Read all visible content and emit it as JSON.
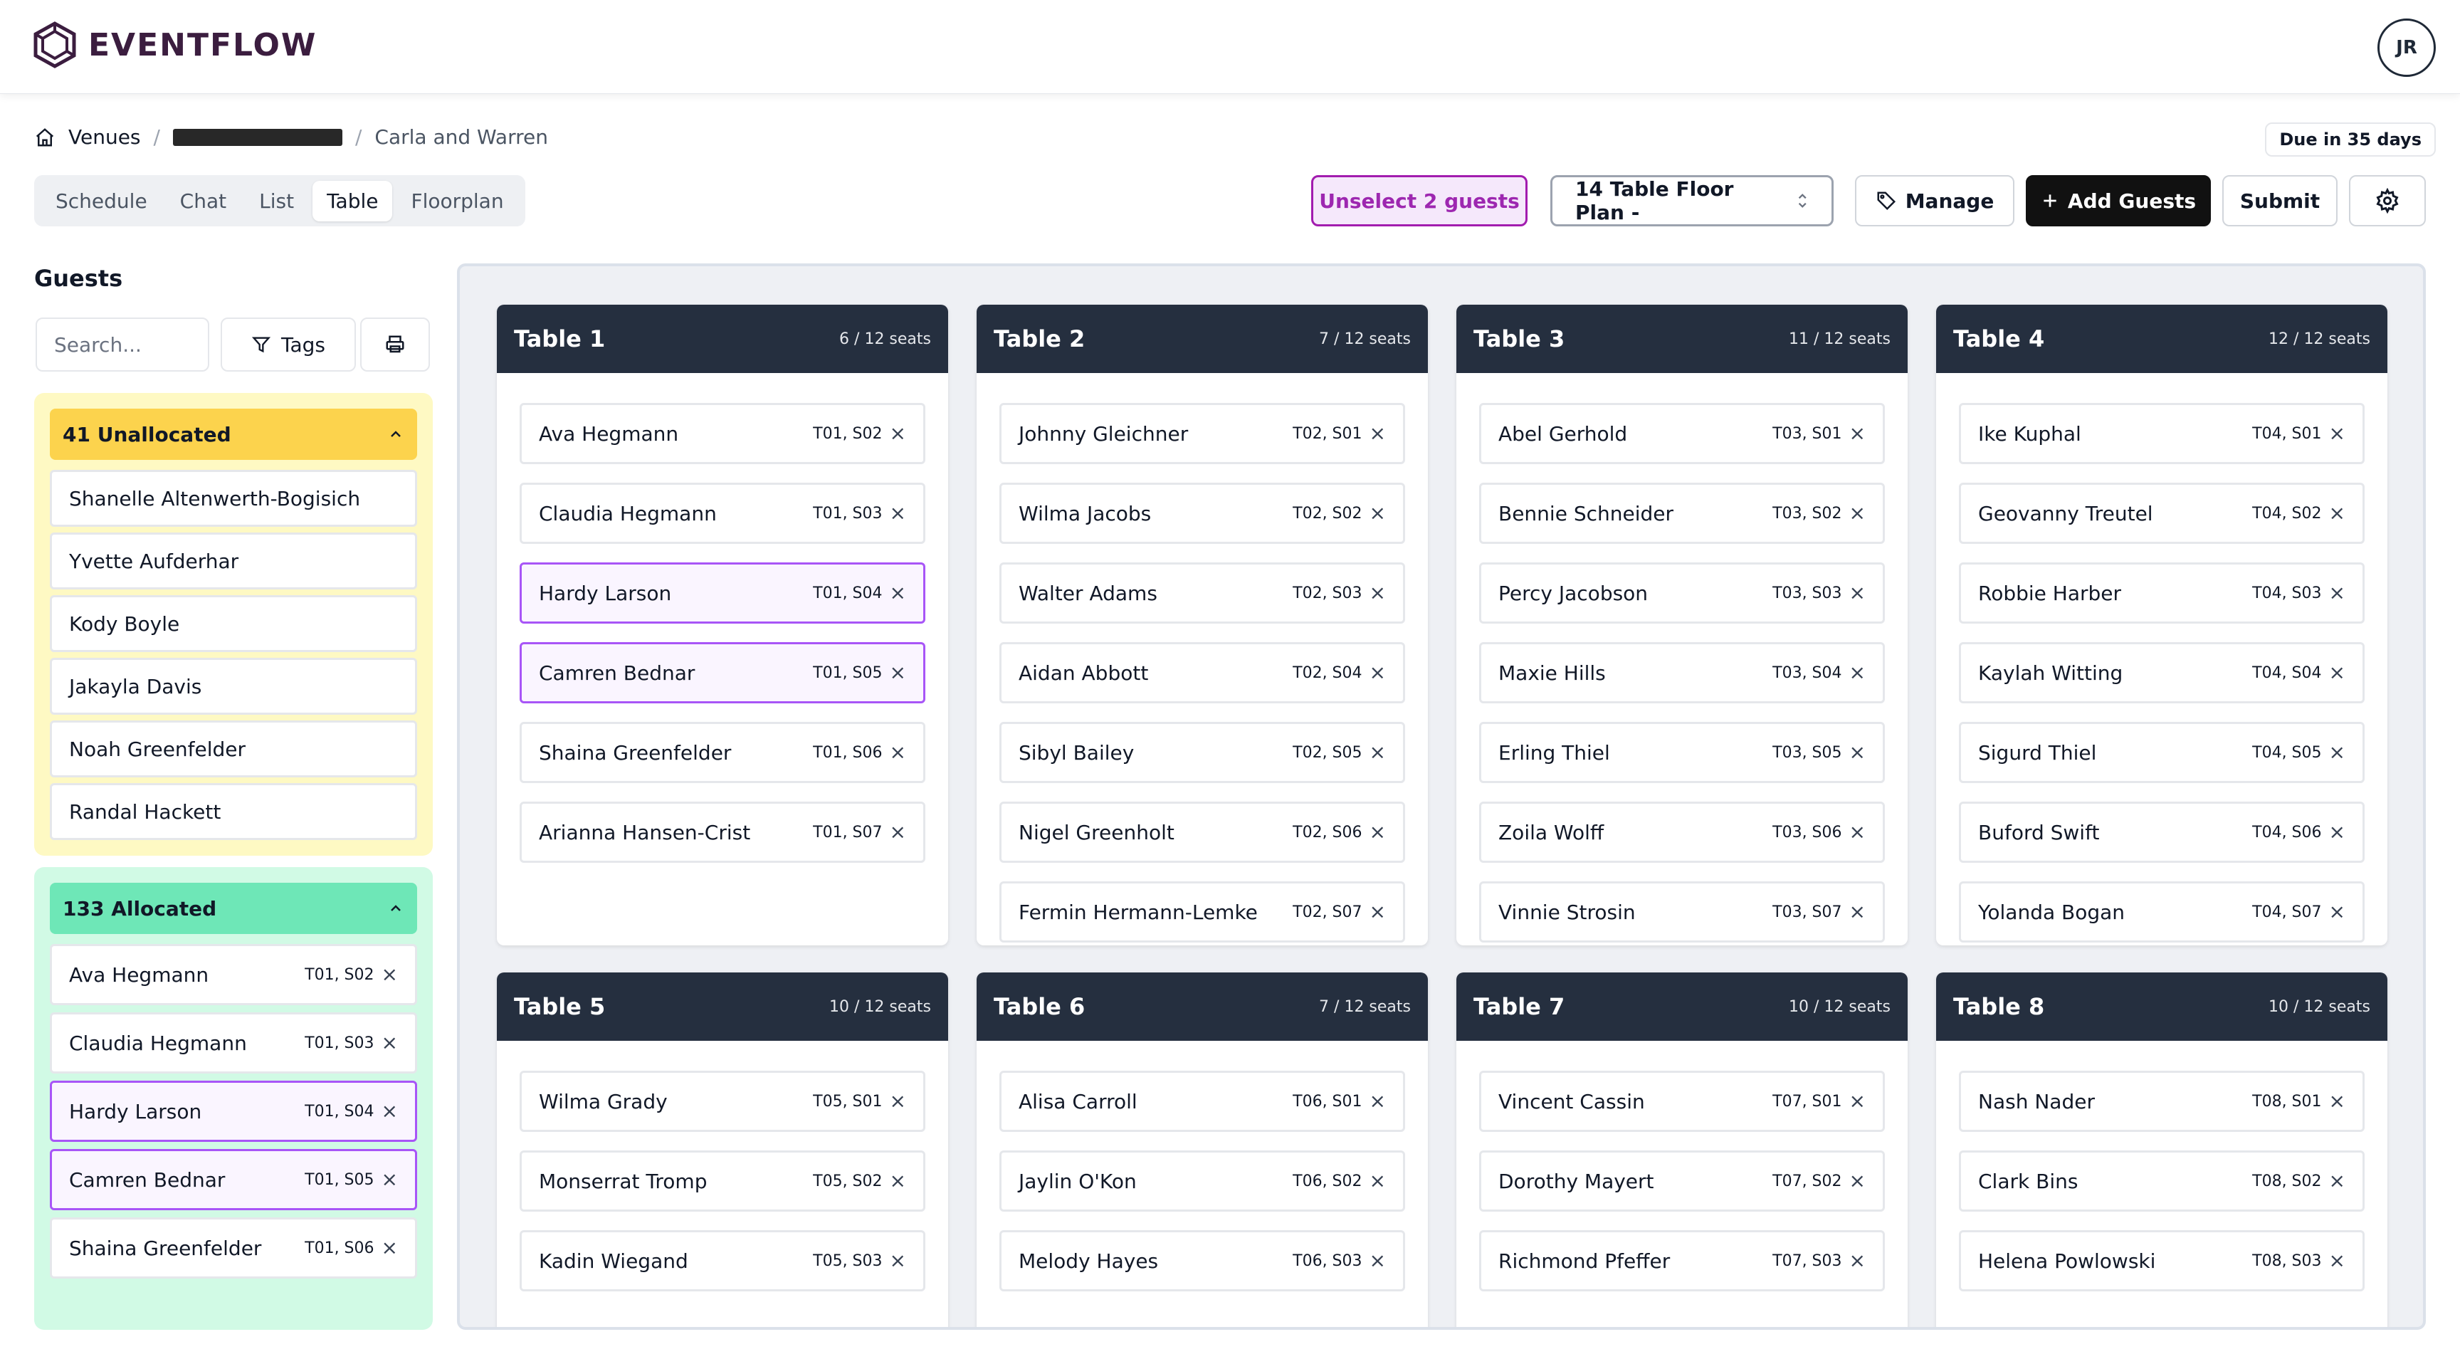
{
  "app": {
    "name": "EVENTFLOW",
    "user_initials": "JR"
  },
  "breadcrumb": {
    "venues": "Venues",
    "sep": "/",
    "current": "Carla and Warren"
  },
  "due": "Due in 35 days",
  "tabs": [
    "Schedule",
    "Chat",
    "List",
    "Table",
    "Floorplan"
  ],
  "active_tab": "Table",
  "toolbar": {
    "unselect": "Unselect 2 guests",
    "floorplan": "14 Table Floor Plan -",
    "manage": "Manage",
    "add_guests": "Add Guests",
    "submit": "Submit"
  },
  "sidebar": {
    "title": "Guests",
    "search_placeholder": "Search...",
    "tags": "Tags",
    "unallocated": {
      "label": "41 Unallocated",
      "items": [
        "Shanelle Altenwerth-Bogisich",
        "Yvette Aufderhar",
        "Kody Boyle",
        "Jakayla Davis",
        "Noah Greenfelder",
        "Randal Hackett"
      ]
    },
    "allocated": {
      "label": "133 Allocated",
      "items": [
        {
          "name": "Ava Hegmann",
          "seat": "T01, S02"
        },
        {
          "name": "Claudia Hegmann",
          "seat": "T01, S03"
        },
        {
          "name": "Hardy Larson",
          "seat": "T01, S04",
          "selected": true
        },
        {
          "name": "Camren Bednar",
          "seat": "T01, S05",
          "selected": true
        },
        {
          "name": "Shaina Greenfelder",
          "seat": "T01, S06"
        }
      ]
    }
  },
  "tables": [
    {
      "name": "Table 1",
      "seats": "6 / 12 seats",
      "guests": [
        {
          "name": "Ava Hegmann",
          "seat": "T01, S02"
        },
        {
          "name": "Claudia Hegmann",
          "seat": "T01, S03"
        },
        {
          "name": "Hardy Larson",
          "seat": "T01, S04",
          "selected": true
        },
        {
          "name": "Camren Bednar",
          "seat": "T01, S05",
          "selected": true
        },
        {
          "name": "Shaina Greenfelder",
          "seat": "T01, S06"
        },
        {
          "name": "Arianna Hansen-Crist",
          "seat": "T01, S07"
        }
      ]
    },
    {
      "name": "Table 2",
      "seats": "7 / 12 seats",
      "guests": [
        {
          "name": "Johnny Gleichner",
          "seat": "T02, S01"
        },
        {
          "name": "Wilma Jacobs",
          "seat": "T02, S02"
        },
        {
          "name": "Walter Adams",
          "seat": "T02, S03"
        },
        {
          "name": "Aidan Abbott",
          "seat": "T02, S04"
        },
        {
          "name": "Sibyl Bailey",
          "seat": "T02, S05"
        },
        {
          "name": "Nigel Greenholt",
          "seat": "T02, S06"
        },
        {
          "name": "Fermin Hermann-Lemke",
          "seat": "T02, S07"
        }
      ]
    },
    {
      "name": "Table 3",
      "seats": "11 / 12 seats",
      "guests": [
        {
          "name": "Abel Gerhold",
          "seat": "T03, S01"
        },
        {
          "name": "Bennie Schneider",
          "seat": "T03, S02"
        },
        {
          "name": "Percy Jacobson",
          "seat": "T03, S03"
        },
        {
          "name": "Maxie Hills",
          "seat": "T03, S04"
        },
        {
          "name": "Erling Thiel",
          "seat": "T03, S05"
        },
        {
          "name": "Zoila Wolff",
          "seat": "T03, S06"
        },
        {
          "name": "Vinnie Strosin",
          "seat": "T03, S07"
        }
      ]
    },
    {
      "name": "Table 4",
      "seats": "12 / 12 seats",
      "guests": [
        {
          "name": "Ike Kuphal",
          "seat": "T04, S01"
        },
        {
          "name": "Geovanny Treutel",
          "seat": "T04, S02"
        },
        {
          "name": "Robbie Harber",
          "seat": "T04, S03"
        },
        {
          "name": "Kaylah Witting",
          "seat": "T04, S04"
        },
        {
          "name": "Sigurd Thiel",
          "seat": "T04, S05"
        },
        {
          "name": "Buford Swift",
          "seat": "T04, S06"
        },
        {
          "name": "Yolanda Bogan",
          "seat": "T04, S07"
        }
      ]
    },
    {
      "name": "Table 5",
      "seats": "10 / 12 seats",
      "guests": [
        {
          "name": "Wilma Grady",
          "seat": "T05, S01"
        },
        {
          "name": "Monserrat Tromp",
          "seat": "T05, S02"
        },
        {
          "name": "Kadin Wiegand",
          "seat": "T05, S03"
        }
      ]
    },
    {
      "name": "Table 6",
      "seats": "7 / 12 seats",
      "guests": [
        {
          "name": "Alisa Carroll",
          "seat": "T06, S01"
        },
        {
          "name": "Jaylin O'Kon",
          "seat": "T06, S02"
        },
        {
          "name": "Melody Hayes",
          "seat": "T06, S03"
        }
      ]
    },
    {
      "name": "Table 7",
      "seats": "10 / 12 seats",
      "guests": [
        {
          "name": "Vincent Cassin",
          "seat": "T07, S01"
        },
        {
          "name": "Dorothy Mayert",
          "seat": "T07, S02"
        },
        {
          "name": "Richmond Pfeffer",
          "seat": "T07, S03"
        }
      ]
    },
    {
      "name": "Table 8",
      "seats": "10 / 12 seats",
      "guests": [
        {
          "name": "Nash Nader",
          "seat": "T08, S01"
        },
        {
          "name": "Clark Bins",
          "seat": "T08, S02"
        },
        {
          "name": "Helena Powlowski",
          "seat": "T08, S03"
        }
      ]
    }
  ],
  "colors": {
    "accent": "#a855f7",
    "header": "#252f3f",
    "unallocated": "#fcd34d",
    "allocated": "#6ee7b7"
  }
}
